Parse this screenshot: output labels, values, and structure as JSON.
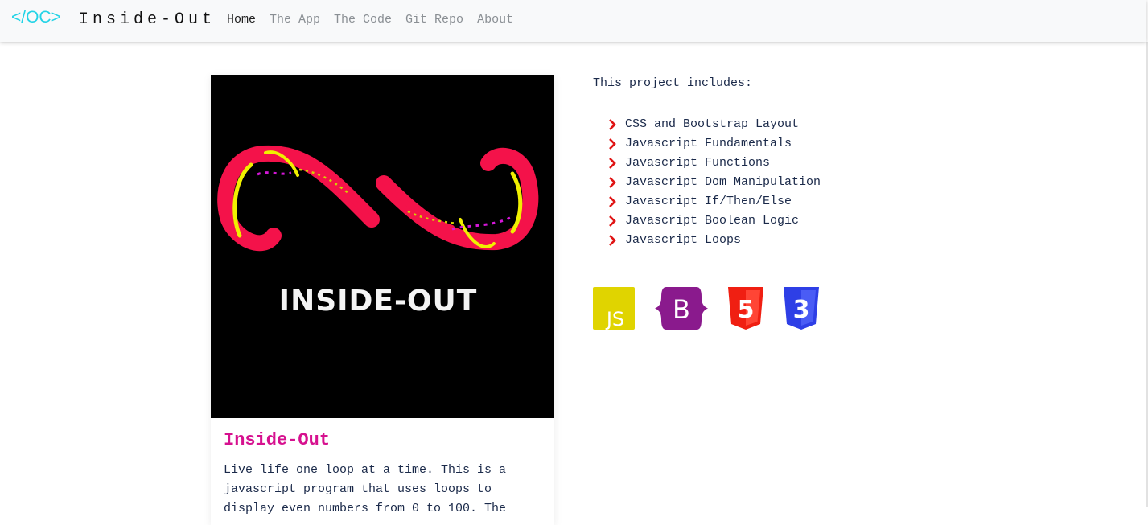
{
  "navbar": {
    "brand_mark": "</OC>",
    "brand_name": "Inside-Out",
    "links": [
      "Home",
      "The App",
      "The Code",
      "Git Repo",
      "About"
    ],
    "active_link": "Home"
  },
  "card": {
    "image_text": "INSIDE-OUT",
    "title": "Inside-Out",
    "description": "Live life one loop at a time. This is a javascript program that uses loops to display even numbers from 0 to 100. The"
  },
  "project": {
    "intro": "This project includes:",
    "features": [
      "CSS and Bootstrap Layout",
      "Javascript Fundamentals",
      "Javascript Functions",
      "Javascript Dom Manipulation",
      "Javascript If/Then/Else",
      "Javascript Boolean Logic",
      "Javascript Loops"
    ],
    "bullet_icon": "chevron-right-icon",
    "bullet_color": "#e01414"
  },
  "tech_icons": [
    {
      "name": "javascript-icon",
      "label": "JS",
      "color": "#e0d400"
    },
    {
      "name": "bootstrap-icon",
      "label": "B",
      "color": "#8a1a8d"
    },
    {
      "name": "html5-icon",
      "label": "5",
      "color": "#f01f12"
    },
    {
      "name": "css3-icon",
      "label": "3",
      "color": "#2e3fe6"
    }
  ],
  "colors": {
    "accent": "#22d3e6",
    "title": "#d6118f",
    "text": "#1b2a4a",
    "navbar_bg": "#f8f9fa"
  }
}
